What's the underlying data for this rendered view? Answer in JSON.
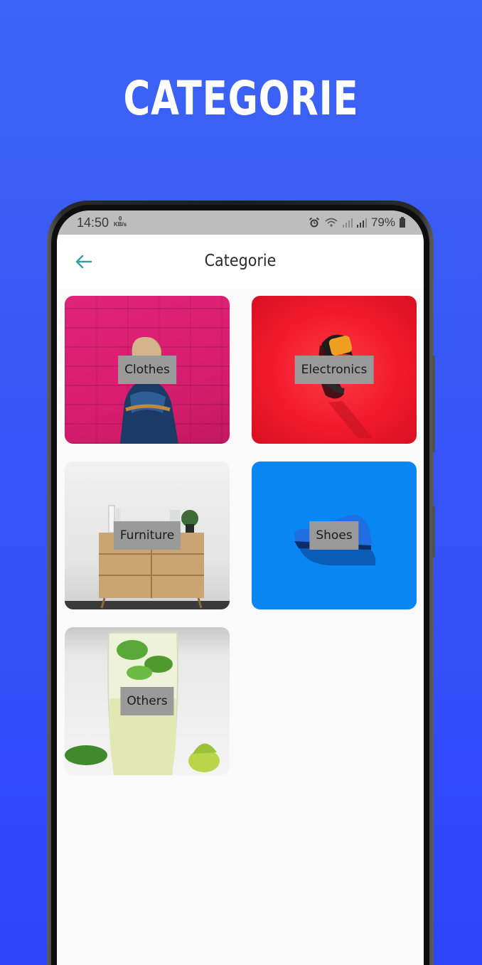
{
  "promo": {
    "title": "CATEGORIE"
  },
  "status_bar": {
    "time": "14:50",
    "net_speed_value": "0",
    "net_speed_unit": "KB/s",
    "battery": "79%"
  },
  "app_bar": {
    "title": "Categorie",
    "back_icon": "arrow-left-icon"
  },
  "categories": [
    {
      "label": "Clothes"
    },
    {
      "label": "Electronics"
    },
    {
      "label": "Furniture"
    },
    {
      "label": "Shoes"
    },
    {
      "label": "Others"
    }
  ],
  "colors": {
    "background": "#3652f8",
    "status_bar": "#bdbdbd",
    "label_bg": "#9a9a9a",
    "back_icon": "#3a9aa0"
  }
}
